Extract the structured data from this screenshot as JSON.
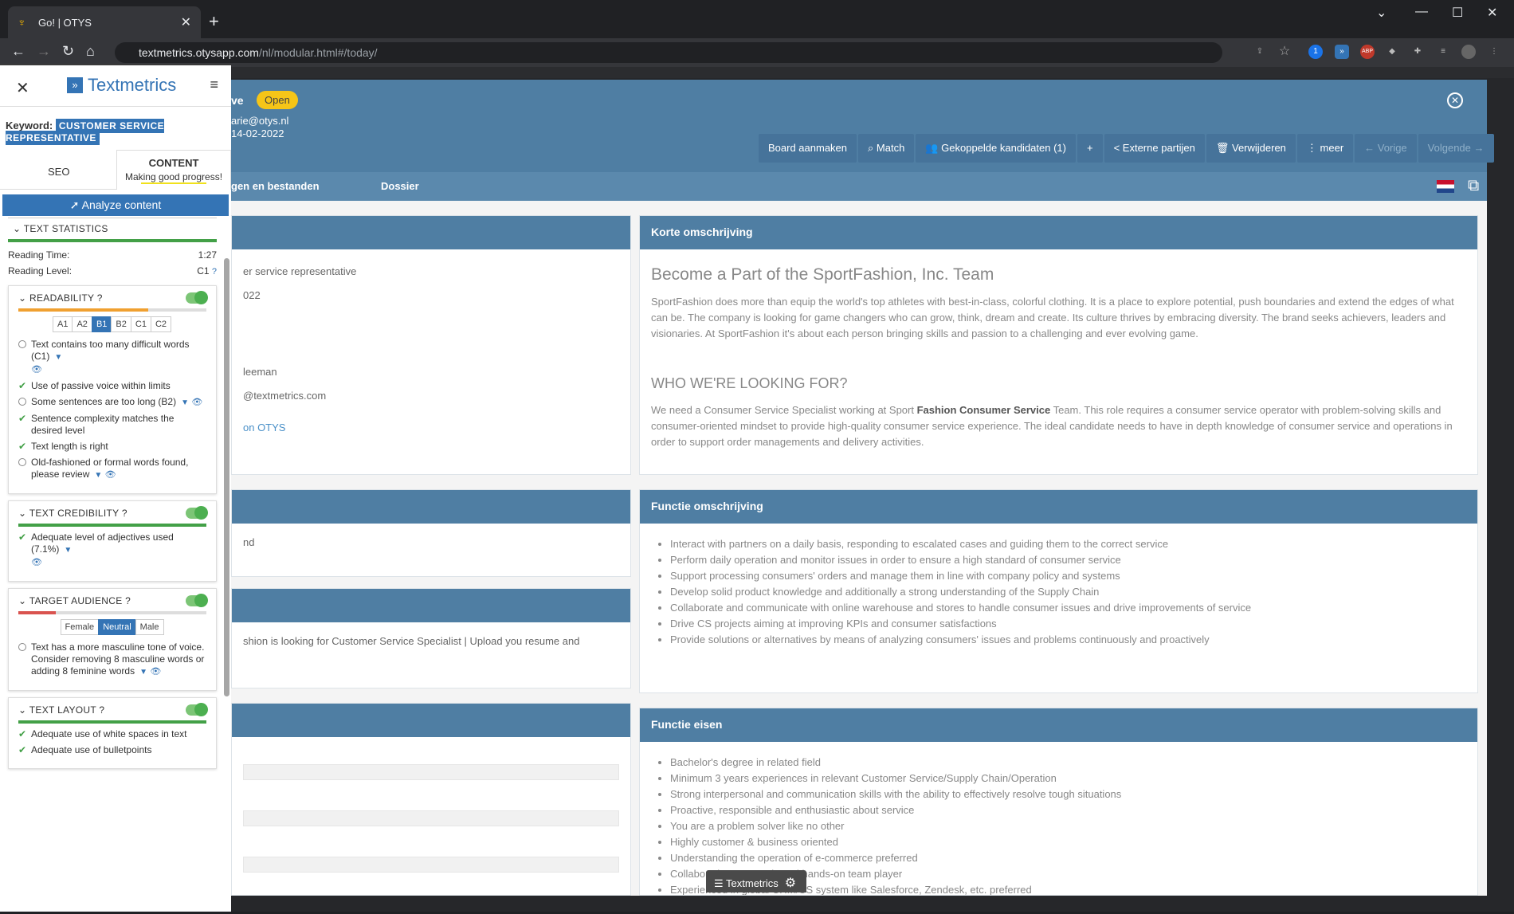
{
  "browser": {
    "tab_title": "Go! | OTYS",
    "url_host": "textmetrics.otysapp.com",
    "url_path": "/nl/modular.html#/today/"
  },
  "modal": {
    "title_fragment": "ve",
    "status": "Open",
    "email_fragment": "arie@otys.nl",
    "date_fragment": "14-02-2022",
    "buttons": [
      "Board aanmaken",
      "Match",
      "Gekoppelde kandidaten (1)",
      "+",
      "Externe partijen",
      "Verwijderen",
      "meer",
      "Vorige",
      "Volgende"
    ],
    "tabs": [
      "gen en bestanden",
      "Dossier"
    ],
    "left_fragments": [
      "er service representative",
      "022",
      "leeman",
      "@textmetrics.com",
      "on OTYS",
      "nd",
      "shion is looking for Customer Service Specialist | Upload you resume and"
    ],
    "korte": {
      "header": "Korte omschrijving",
      "title1": "Become a Part of the SportFashion, Inc. Team",
      "p1": "SportFashion does more than equip the world's top athletes with best-in-class, colorful clothing. It is a place to explore potential, push boundaries and extend the edges of what can be. The company is looking for game changers who can grow, think, dream and create. Its culture thrives by embracing diversity. The brand seeks achievers, leaders and visionaries. At SportFashion it's about each person bringing skills and passion to a challenging and ever evolving game.",
      "title2": "WHO WE'RE LOOKING FOR?",
      "p2a": "We need a Consumer Service Specialist working at Sport ",
      "p2b": "Fashion Consumer Service",
      "p2c": " Team. This role requires a consumer service operator with problem-solving skills and consumer-oriented mindset to provide high-quality consumer service experience. The ideal candidate needs to have in depth knowledge of consumer service and operations in order to support order managements and delivery activities."
    },
    "functie": {
      "header": "Functie omschrijving",
      "items": [
        "Interact with partners on a daily basis, responding to escalated cases and guiding them to the correct service",
        "Perform daily operation and monitor issues in order to ensure a high standard of consumer service",
        "Support processing consumers' orders and manage them in line with company policy and systems",
        "Develop solid product knowledge and additionally a strong understanding of the Supply Chain",
        "Collaborate and communicate with online warehouse and stores to handle consumer issues and drive improvements of service",
        "Drive CS projects aiming at improving KPIs and consumer satisfactions",
        "Provide solutions or alternatives by means of analyzing consumers' issues and problems continuously and proactively"
      ]
    },
    "eisen": {
      "header": "Functie eisen",
      "items": [
        "Bachelor's degree in related field",
        "Minimum 3 years experiences in relevant Customer Service/Supply Chain/Operation",
        "Strong interpersonal and communication skills with the ability to effectively resolve tough situations",
        "Proactive, responsible and enthusiastic about service",
        "You are a problem solver like no other",
        "Highly customer & business oriented",
        "Understanding the operation of e-commerce preferred",
        "Collaborative, energetic and hands-on team player",
        "Experienced in global CRM/CS system like Salesforce, Zendesk, etc. preferred"
      ]
    }
  },
  "textmetrics_button": "Textmetrics",
  "panel": {
    "logo": "Textmetrics",
    "keyword_label": "Keyword:",
    "keyword": "CUSTOMER SERVICE REPRESENTATIVE",
    "tab_seo": "SEO",
    "tab_content": "CONTENT",
    "progress_msg": "Making good progress!",
    "analyze": "Analyze content",
    "stats": {
      "title": "TEXT STATISTICS",
      "reading_time_label": "Reading Time:",
      "reading_time": "1:27",
      "reading_level_label": "Reading Level:",
      "reading_level": "C1"
    },
    "readability": {
      "title": "READABILITY",
      "score": 0.69,
      "levels": [
        "A1",
        "A2",
        "B1",
        "B2",
        "C1",
        "C2"
      ],
      "selected": "B1",
      "items": [
        {
          "status": "open",
          "text": "Text contains too many difficult words (C1)"
        },
        {
          "status": "ok",
          "text": "Use of passive voice within limits"
        },
        {
          "status": "open",
          "text": "Some sentences are too long (B2)"
        },
        {
          "status": "ok",
          "text": "Sentence complexity matches the desired level"
        },
        {
          "status": "ok",
          "text": "Text length is right"
        },
        {
          "status": "open",
          "text": "Old-fashioned or formal words found, please review"
        }
      ]
    },
    "credibility": {
      "title": "TEXT CREDIBILITY",
      "score": 1.0,
      "item": "Adequate level of adjectives used (7.1%)"
    },
    "audience": {
      "title": "TARGET AUDIENCE",
      "score": 0.2,
      "options": [
        "Female",
        "Neutral",
        "Male"
      ],
      "selected": "Neutral",
      "item": "Text has a more masculine tone of voice. Consider removing 8 masculine words or adding 8 feminine words"
    },
    "layout": {
      "title": "TEXT LAYOUT",
      "score": 1.0,
      "items": [
        "Adequate use of white spaces in text",
        "Adequate use of bulletpoints"
      ]
    }
  },
  "colors": {
    "accent": "#3474b5",
    "header": "#4f7ea3",
    "ok": "#43a047",
    "warn": "#f0a030",
    "bad": "#d9534f"
  }
}
